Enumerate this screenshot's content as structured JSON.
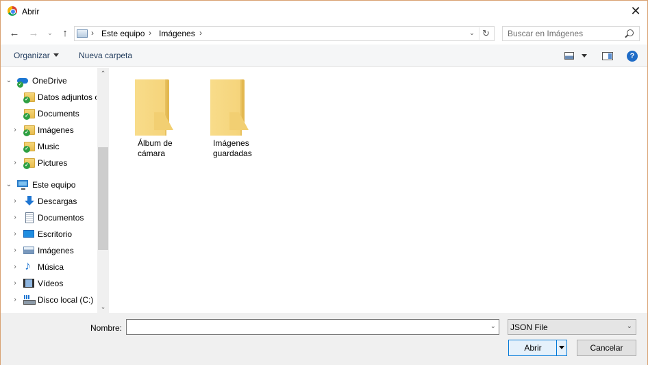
{
  "window": {
    "title": "Abrir",
    "close_glyph": "✕",
    "border_color": "#d8a070"
  },
  "nav": {
    "back_glyph": "←",
    "forward_glyph": "→",
    "recent_glyph": "⌄",
    "up_glyph": "↑",
    "breadcrumbs": [
      "Este equipo",
      "Imágenes"
    ],
    "separator": "›",
    "dropdown_glyph": "⌄",
    "refresh_glyph": "↻"
  },
  "search": {
    "placeholder": "Buscar en Imágenes"
  },
  "toolbar": {
    "organize_label": "Organizar",
    "new_folder_label": "Nueva carpeta",
    "help_glyph": "?"
  },
  "navpane": {
    "items": [
      {
        "label": "OneDrive",
        "icon": "onedrive-icon",
        "expanded": true
      },
      {
        "label": "Datos adjuntos c",
        "icon": "synced-folder-icon"
      },
      {
        "label": "Documents",
        "icon": "synced-folder-icon"
      },
      {
        "label": "Imágenes",
        "icon": "synced-folder-icon"
      },
      {
        "label": "Music",
        "icon": "synced-folder-icon"
      },
      {
        "label": "Pictures",
        "icon": "synced-folder-icon"
      },
      {
        "label": "Este equipo",
        "icon": "computer-icon",
        "expanded": true
      },
      {
        "label": "Descargas",
        "icon": "downloads-icon"
      },
      {
        "label": "Documentos",
        "icon": "documents-icon"
      },
      {
        "label": "Escritorio",
        "icon": "desktop-icon"
      },
      {
        "label": "Imágenes",
        "icon": "pictures-icon"
      },
      {
        "label": "Música",
        "icon": "music-icon"
      },
      {
        "label": "Vídeos",
        "icon": "videos-icon"
      },
      {
        "label": "Disco local (C:)",
        "icon": "local-disk-icon"
      }
    ],
    "expanded_glyph": "⌄",
    "collapsed_glyph": "›",
    "scroll_up_glyph": "⌃",
    "scroll_down_glyph": "⌄"
  },
  "content": {
    "folders": [
      {
        "line1": "Álbum de",
        "line2": "cámara"
      },
      {
        "line1": "Imágenes",
        "line2": "guardadas"
      }
    ]
  },
  "bottom": {
    "filename_label": "Nombre:",
    "filename_value": "",
    "filetype_value": "JSON File",
    "open_label": "Abrir",
    "cancel_label": "Cancelar",
    "accent": "#0078d7"
  }
}
